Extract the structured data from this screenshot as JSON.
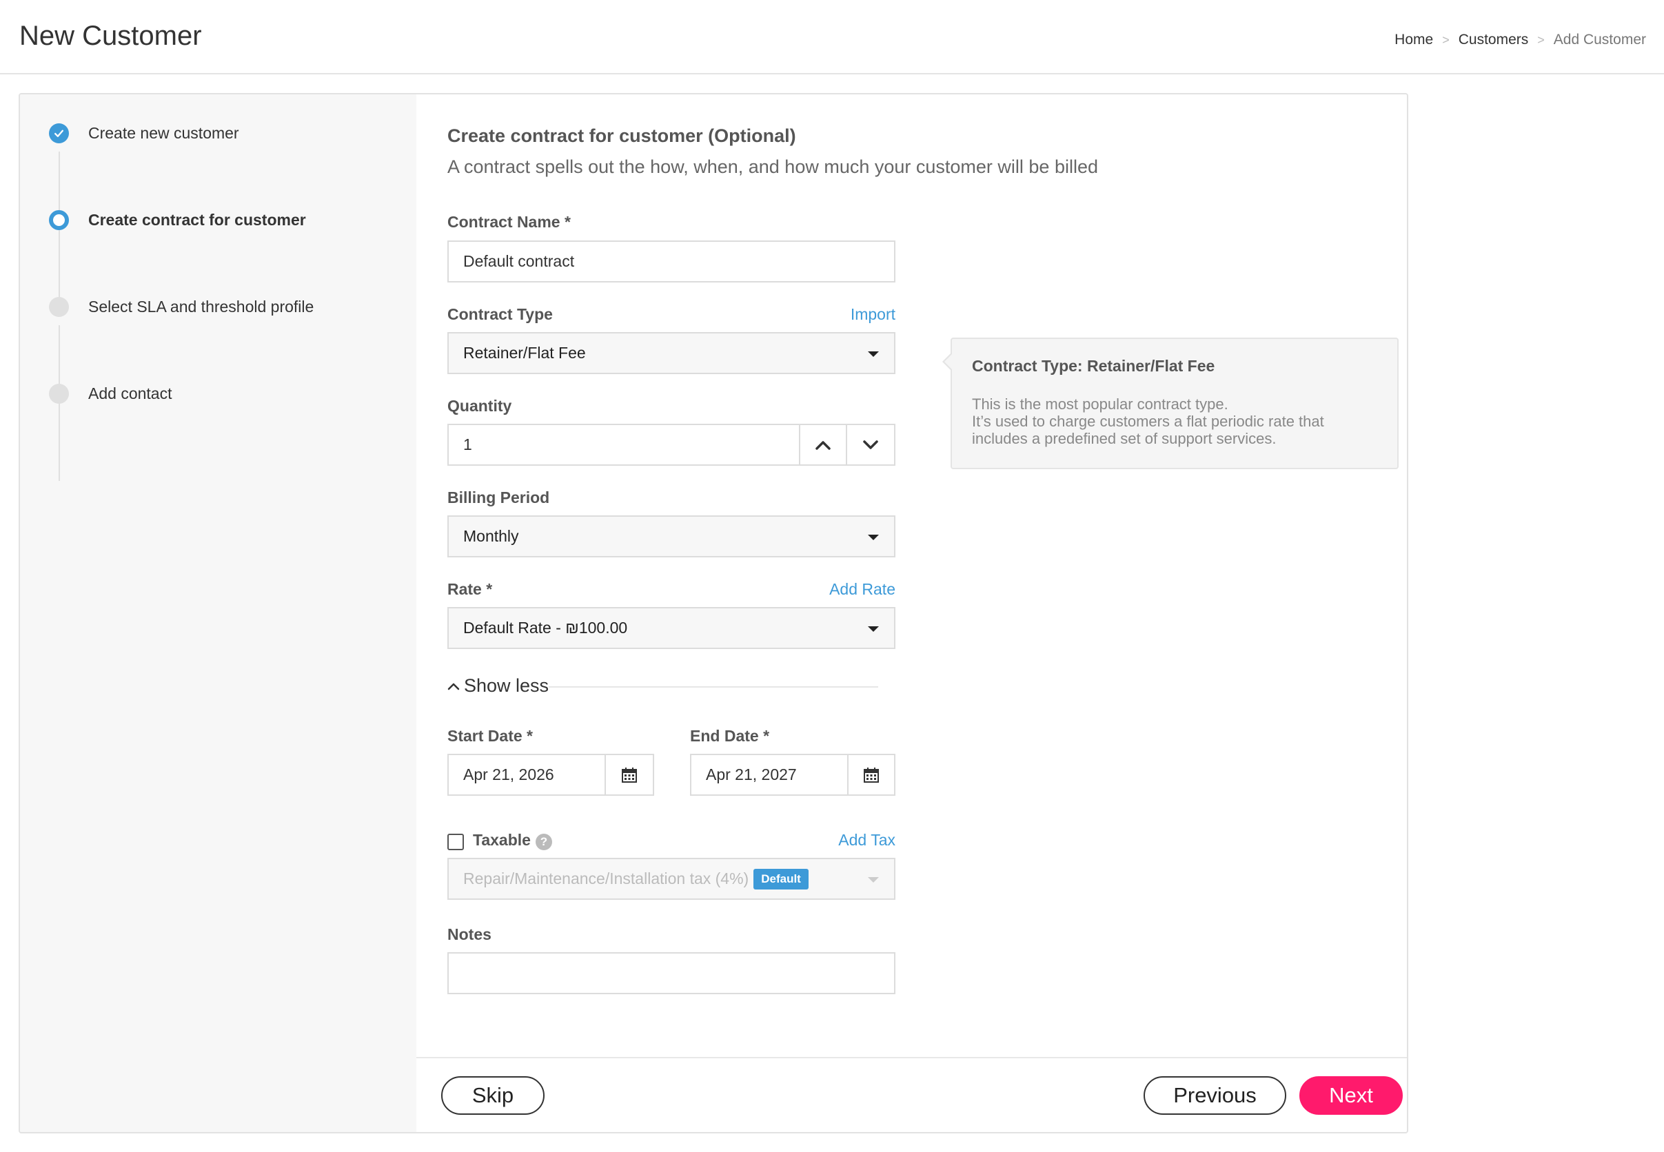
{
  "header": {
    "title": "New Customer",
    "breadcrumb": {
      "home": "Home",
      "customers": "Customers",
      "current": "Add Customer",
      "separator": ">"
    }
  },
  "steps": [
    {
      "label": "Create new customer",
      "state": "done"
    },
    {
      "label": "Create contract for customer",
      "state": "active"
    },
    {
      "label": "Select SLA and threshold profile",
      "state": "pending"
    },
    {
      "label": "Add contact",
      "state": "pending"
    }
  ],
  "form": {
    "title": "Create contract for customer (Optional)",
    "subtitle": "A contract spells out the how, when, and how much your customer will be billed",
    "contract_name": {
      "label": "Contract Name *",
      "value": "Default contract"
    },
    "contract_type": {
      "label": "Contract Type",
      "link": "Import",
      "value": "Retainer/Flat Fee"
    },
    "quantity": {
      "label": "Quantity",
      "value": "1"
    },
    "billing_period": {
      "label": "Billing Period",
      "value": "Monthly"
    },
    "rate": {
      "label": "Rate *",
      "link": "Add Rate",
      "value": "Default Rate - ₪100.00"
    },
    "show_less": "Show less",
    "start_date": {
      "label": "Start Date *",
      "value": "Apr 21, 2026"
    },
    "end_date": {
      "label": "End Date *",
      "value": "Apr 21, 2027"
    },
    "taxable": {
      "label": "Taxable",
      "link": "Add Tax",
      "checked": false,
      "value": "Repair/Maintenance/Installation tax (4%)",
      "badge": "Default"
    },
    "notes": {
      "label": "Notes",
      "value": ""
    }
  },
  "info_box": {
    "title": "Contract Type: Retainer/Flat Fee",
    "line1": "This is the most popular contract type.",
    "line2": "It’s used to charge customers a flat periodic rate that",
    "line3": "includes a predefined set of support services."
  },
  "footer": {
    "skip": "Skip",
    "previous": "Previous",
    "next": "Next"
  },
  "colors": {
    "accent": "#3d9ad8",
    "primary_button": "#ff1a6c",
    "sidebar_bg": "#f7f7f7"
  }
}
